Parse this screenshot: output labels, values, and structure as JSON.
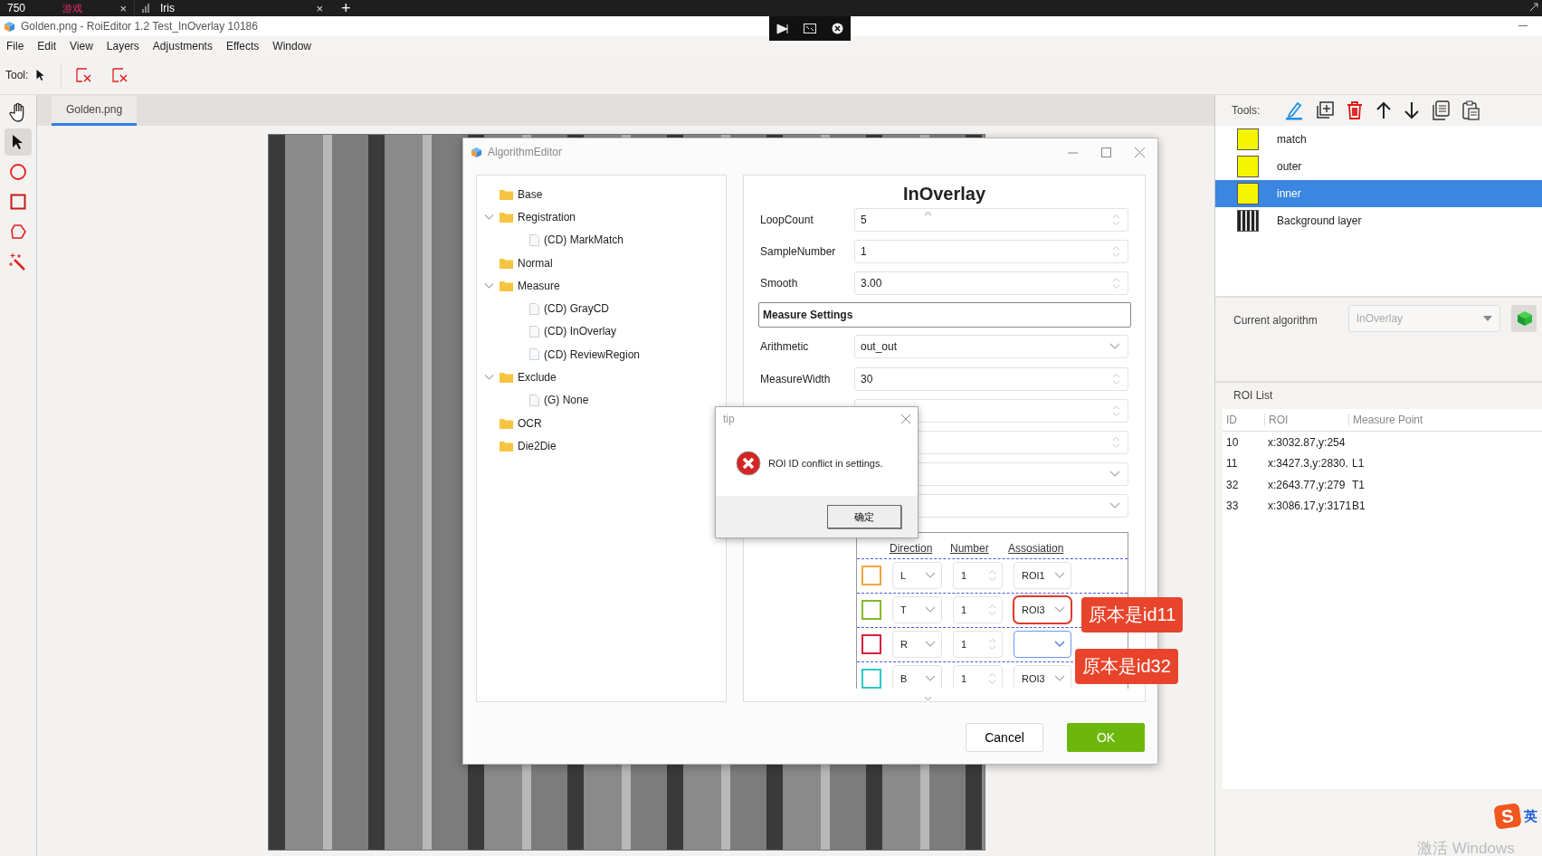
{
  "browser_tabs": [
    {
      "label": "750",
      "badge": "游戏",
      "close": "×"
    },
    {
      "label": "Iris",
      "close": "×"
    }
  ],
  "browser_new_tab": "+",
  "window": {
    "title": "Golden.png - RoiEditor 1.2 Test_InOverlay 10186"
  },
  "menu": [
    "File",
    "Edit",
    "View",
    "Layers",
    "Adjustments",
    "Effects",
    "Window"
  ],
  "toolbar": {
    "label": "Tool:"
  },
  "left_tools": [
    {
      "kind": "hand",
      "selected": false
    },
    {
      "kind": "pointer",
      "selected": true
    },
    {
      "kind": "circle",
      "selected": false
    },
    {
      "kind": "rectangle",
      "selected": false
    },
    {
      "kind": "polygon",
      "selected": false
    },
    {
      "kind": "wand",
      "selected": false
    }
  ],
  "document_tabs": [
    {
      "label": "Golden.png",
      "selected": true
    }
  ],
  "algorithm_editor": {
    "title": "AlgorithmEditor",
    "tree": [
      {
        "label": "Base",
        "kind": "folder"
      },
      {
        "label": "Registration",
        "kind": "folder",
        "expanded": true,
        "children": [
          {
            "label": "(CD) MarkMatch",
            "kind": "file"
          }
        ]
      },
      {
        "label": "Normal",
        "kind": "folder"
      },
      {
        "label": "Measure",
        "kind": "folder",
        "expanded": true,
        "children": [
          {
            "label": "(CD) GrayCD",
            "kind": "file"
          },
          {
            "label": "(CD) InOverlay",
            "kind": "file"
          },
          {
            "label": "(CD) ReviewRegion",
            "kind": "file"
          }
        ]
      },
      {
        "label": "Exclude",
        "kind": "folder",
        "expanded": true,
        "children": [
          {
            "label": "(G) None",
            "kind": "file"
          }
        ]
      },
      {
        "label": "OCR",
        "kind": "folder"
      },
      {
        "label": "Die2Die",
        "kind": "folder"
      }
    ],
    "heading": "InOverlay",
    "fields": [
      {
        "kind": "spin",
        "label": "LoopCount",
        "value": "5"
      },
      {
        "kind": "spin",
        "label": "SampleNumber",
        "value": "1"
      },
      {
        "kind": "spin",
        "label": "Smooth",
        "value": "3.00"
      },
      {
        "kind": "section",
        "label": "Measure Settings"
      },
      {
        "kind": "combo",
        "label": "Arithmetic",
        "value": "out_out"
      },
      {
        "kind": "spin",
        "label": "MeasureWidth",
        "value": "30"
      },
      {
        "kind": "spin"
      },
      {
        "kind": "spin"
      },
      {
        "kind": "combo"
      },
      {
        "kind": "combo"
      }
    ],
    "points_table": {
      "columns": [
        "Direction",
        "Number",
        "Assosiation"
      ],
      "rows": [
        {
          "color": "#f0a640",
          "direction": "L",
          "number": "1",
          "association": "ROI1",
          "annotated": false,
          "focused": false
        },
        {
          "color": "#86b830",
          "direction": "T",
          "number": "1",
          "association": "ROI3",
          "annotated": true,
          "focused": false
        },
        {
          "color": "#d8203c",
          "direction": "R",
          "number": "1",
          "annotated": false,
          "focused": true
        },
        {
          "color": "#30c8c8",
          "direction": "B",
          "number": "1",
          "association": "ROI3",
          "annotated": false,
          "focused": false
        }
      ]
    },
    "buttons": [
      "Cancel",
      "OK"
    ]
  },
  "tip": {
    "title": "tip",
    "message": "ROI ID conflict in settings.",
    "button": "确定"
  },
  "annotations": [
    "原本是id11",
    "原本是id32"
  ],
  "right_panel": {
    "tools_label": "Tools:",
    "layers": [
      {
        "name": "match",
        "kind": "roi",
        "selected": false
      },
      {
        "name": "outer",
        "kind": "roi",
        "selected": false
      },
      {
        "name": "inner",
        "kind": "roi",
        "selected": true
      },
      {
        "name": "Background layer",
        "kind": "image",
        "selected": false
      }
    ],
    "current_algorithm": {
      "label": "Current algorithm",
      "value": "InOverlay"
    },
    "roi_list": {
      "title": "ROI List",
      "columns": [
        "ID",
        "ROI",
        "Measure Point"
      ],
      "rows": [
        [
          "10",
          "x:3032.87,y:254",
          ""
        ],
        [
          "11",
          "x:3427.3,y:2830.",
          "L1"
        ],
        [
          "32",
          "x:2643.77,y:279",
          "T1"
        ],
        [
          "33",
          "x:3086.17,y:3171",
          "B1"
        ]
      ]
    }
  },
  "ime": {
    "logo": "S",
    "mode": "英"
  },
  "os_notice": "激活 Windows"
}
